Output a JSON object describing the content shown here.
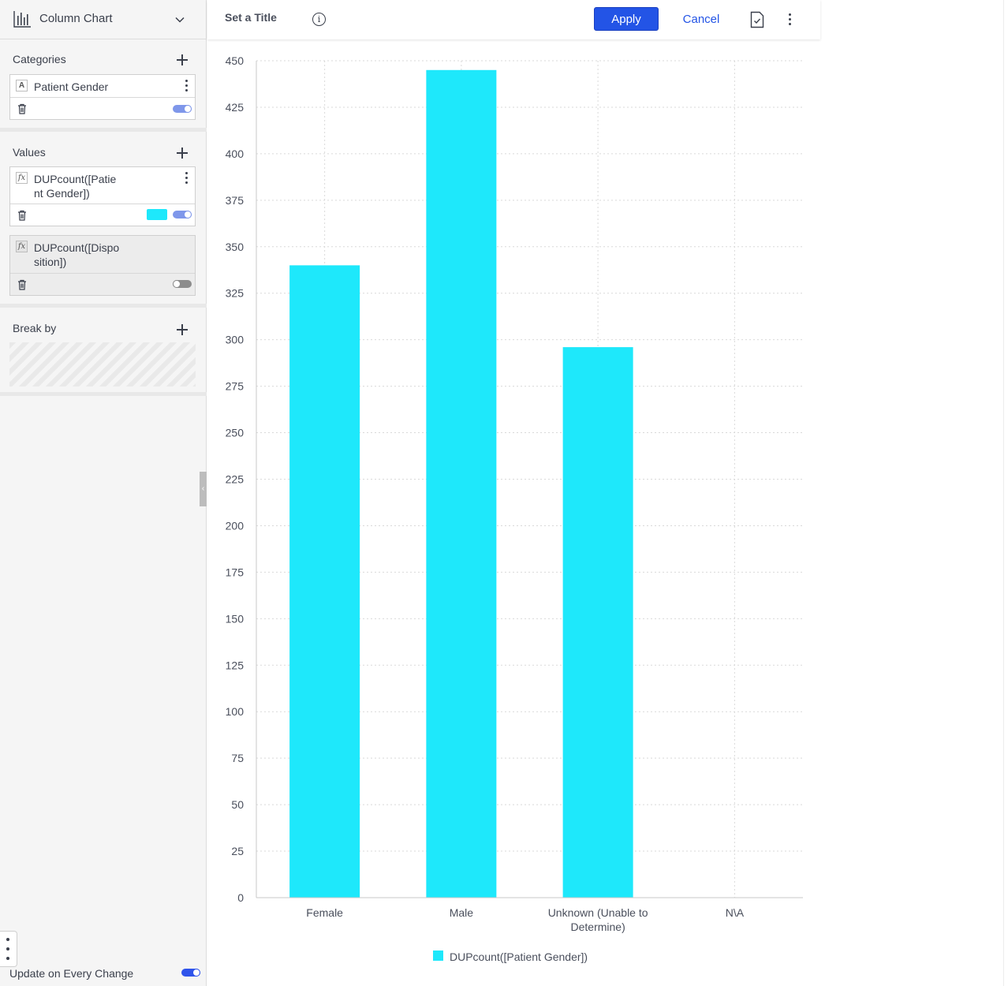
{
  "sidebar": {
    "chart_type_label": "Column Chart",
    "categories": {
      "title": "Categories",
      "items": [
        {
          "type_badge": "A",
          "label": "Patient Gender",
          "enabled": true
        }
      ]
    },
    "values": {
      "title": "Values",
      "items": [
        {
          "type_badge": "fx",
          "label_line1": "DUPcount([Patie",
          "label_line2": "nt Gender])",
          "color": "#1ee8fb",
          "enabled": true
        },
        {
          "type_badge": "fx",
          "label_line1": "DUPcount([Dispo",
          "label_line2": "sition])",
          "enabled": false
        }
      ]
    },
    "break_by": {
      "title": "Break by"
    },
    "update_on_change": {
      "label": "Update on Every Change",
      "enabled": true
    }
  },
  "toolbar": {
    "title_placeholder": "Set a Title",
    "info_glyph": "i",
    "apply_label": "Apply",
    "cancel_label": "Cancel"
  },
  "colors": {
    "accent": "#2354e6",
    "series": "#1ee8fb",
    "toggle_on": "#7f97ea"
  },
  "chart_data": {
    "type": "bar",
    "categories": [
      "Female",
      "Male",
      "Unknown (Unable to Determine)",
      "N\\A"
    ],
    "category_lines": [
      [
        "Female"
      ],
      [
        "Male"
      ],
      [
        "Unknown (Unable to",
        "Determine)"
      ],
      [
        "N\\A"
      ]
    ],
    "series": [
      {
        "name": "DUPcount([Patient Gender])",
        "values": [
          340,
          445,
          296,
          0
        ],
        "color": "#1ee8fb"
      }
    ],
    "ylim": [
      0,
      450
    ],
    "yticks": [
      0,
      25,
      50,
      75,
      100,
      125,
      150,
      175,
      200,
      225,
      250,
      275,
      300,
      325,
      350,
      375,
      400,
      425,
      450
    ],
    "grid": true,
    "legend": "bottom"
  }
}
